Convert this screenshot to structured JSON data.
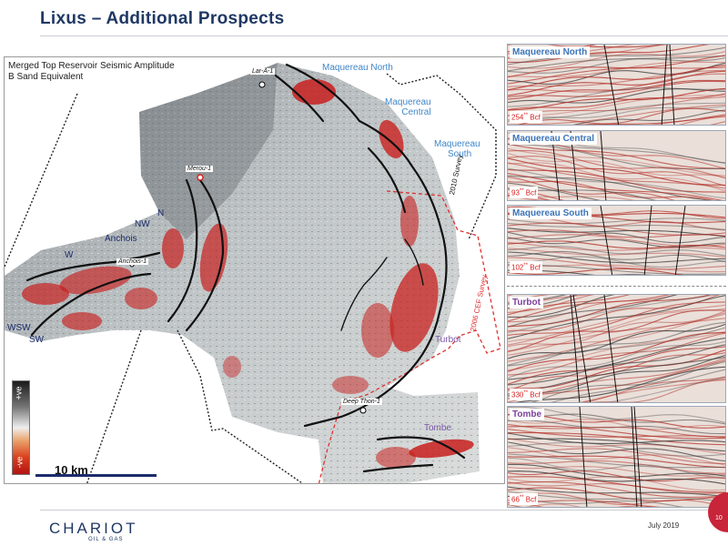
{
  "header": {
    "title": "Lixus – Additional Prospects"
  },
  "map": {
    "caption_line1": "Merged Top Reservoir Seismic Amplitude",
    "caption_line2": "B Sand Equivalent",
    "labels": {
      "maquereau_north": "Maquereau North",
      "maquereau_central_1": "Maquereau",
      "maquereau_central_2": "Central",
      "maquereau_south_1": "Maquereau",
      "maquereau_south_2": "South",
      "turbot": "Turbot",
      "tombe": "Tombe",
      "anchois": "Anchois",
      "n": "N",
      "nw": "NW",
      "w": "W",
      "wsw": "WSW",
      "sw": "SW"
    },
    "wells": {
      "lar_a1": "Lar-A-1",
      "merou1": "Merou-1",
      "anchois1": "Anchois-1",
      "deep_thon1": "Deep Thon-1"
    },
    "surveys": {
      "s2010": "2010 Survey",
      "s2006": "2006 CEF Survey"
    },
    "colorbar": {
      "pos": "+ve",
      "neg": "-ve"
    },
    "scale": "10 km",
    "colors": {
      "amplitude_red": "#c8201e",
      "boundary": "#111111",
      "survey_dash": "#e03030"
    }
  },
  "panels": [
    {
      "name": "Maquereau North",
      "volume": "254",
      "unit": " Bcf",
      "sup": "**",
      "style": "blue"
    },
    {
      "name": "Maquereau Central",
      "volume": "93",
      "unit": " Bcf",
      "sup": "**",
      "style": "blue"
    },
    {
      "name": "Maquereau South",
      "volume": "102",
      "unit": " Bcf",
      "sup": "**",
      "style": "blue"
    },
    {
      "name": "Turbot",
      "volume": "330",
      "unit": " Bcf",
      "sup": "**",
      "style": "purple"
    },
    {
      "name": "Tombe",
      "volume": "66",
      "unit": " Bcf",
      "sup": "**",
      "style": "purple"
    }
  ],
  "footer": {
    "logo": "CHARIOT",
    "logo_sub": "OIL & GAS",
    "date": "July 2019",
    "page": "10"
  }
}
